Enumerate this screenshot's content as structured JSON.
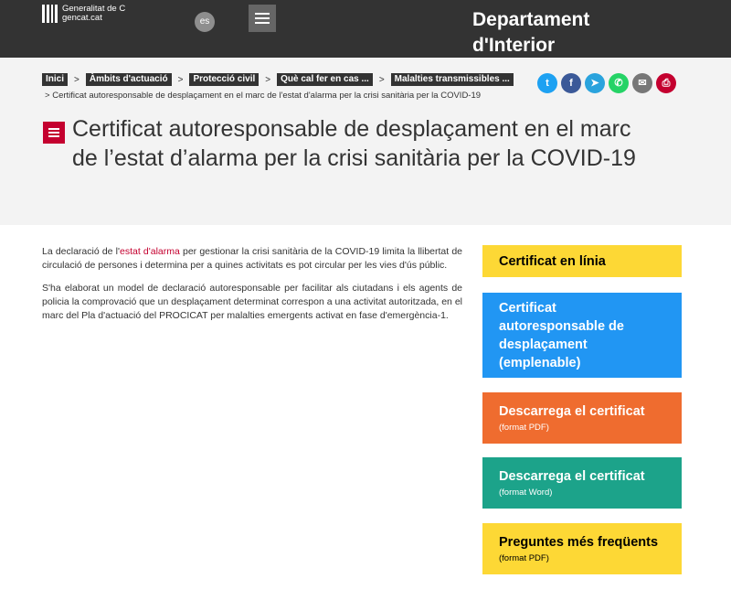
{
  "topbar": {
    "logo_line1": "Generalitat de C",
    "logo_line2": "gencat.cat",
    "lang_label": "es",
    "menu_icon": "hamburger-icon",
    "department": "Departament d'Interior"
  },
  "breadcrumb": {
    "items": [
      "Inici",
      "Àmbits d'actuació",
      "Protecció civil",
      "Què cal fer en cas ...",
      "Malalties transmissibles ..."
    ],
    "separator": ">",
    "current": "Certificat autoresponsable de desplaçament en el marc de l'estat d'alarma per la crisi sanitària per la COVID-19"
  },
  "share": [
    {
      "icon": "twitter-icon",
      "glyph": "t",
      "color": "#1da1f2"
    },
    {
      "icon": "facebook-icon",
      "glyph": "f",
      "color": "#3b5998"
    },
    {
      "icon": "telegram-icon",
      "glyph": "➤",
      "color": "#2aa3dd"
    },
    {
      "icon": "whatsapp-icon",
      "glyph": "✆",
      "color": "#25d366"
    },
    {
      "icon": "email-icon",
      "glyph": "✉",
      "color": "#777777"
    },
    {
      "icon": "print-icon",
      "glyph": "⎙",
      "color": "#c4002f"
    }
  ],
  "page": {
    "title": "Certificat autoresponsable de desplaçament en el marc de l’estat d’alarma per la crisi sanitària per la COVID-19",
    "title_icon": "list-icon"
  },
  "body": {
    "p1_before": "La declaració de l'",
    "p1_link": "estat d'alarma",
    "p1_after": " per gestionar la crisi sanitària de la COVID-19 limita la llibertat de circulació de persones i determina per a quines activitats es pot circular per les vies d'ús públic.",
    "p2": "S'ha elaborat un model de declaració autoresponsable per facilitar als ciutadans i els agents de policia la comprovació que un desplaçament determinat correspon a una activitat autoritzada, en el marc del Pla d'actuació del PROCICAT per malalties emergents activat en fase d'emergència-1."
  },
  "ctas": [
    {
      "title": "Certificat en línia",
      "sub": "",
      "bg": "#fdd835",
      "fg": "#000000"
    },
    {
      "title": "Certificat autoresponsable de desplaçament (emplenable)",
      "sub": "",
      "bg": "#2196f3",
      "fg": "#ffffff"
    },
    {
      "title": "Descarrega el certificat",
      "sub": "(format PDF)",
      "bg": "#ef6c2f",
      "fg": "#ffffff"
    },
    {
      "title": "Descarrega el certificat",
      "sub": "(format Word)",
      "bg": "#1ca38a",
      "fg": "#ffffff"
    },
    {
      "title": "Preguntes més freqüents",
      "sub": "(format PDF)",
      "bg": "#fdd835",
      "fg": "#000000"
    }
  ]
}
